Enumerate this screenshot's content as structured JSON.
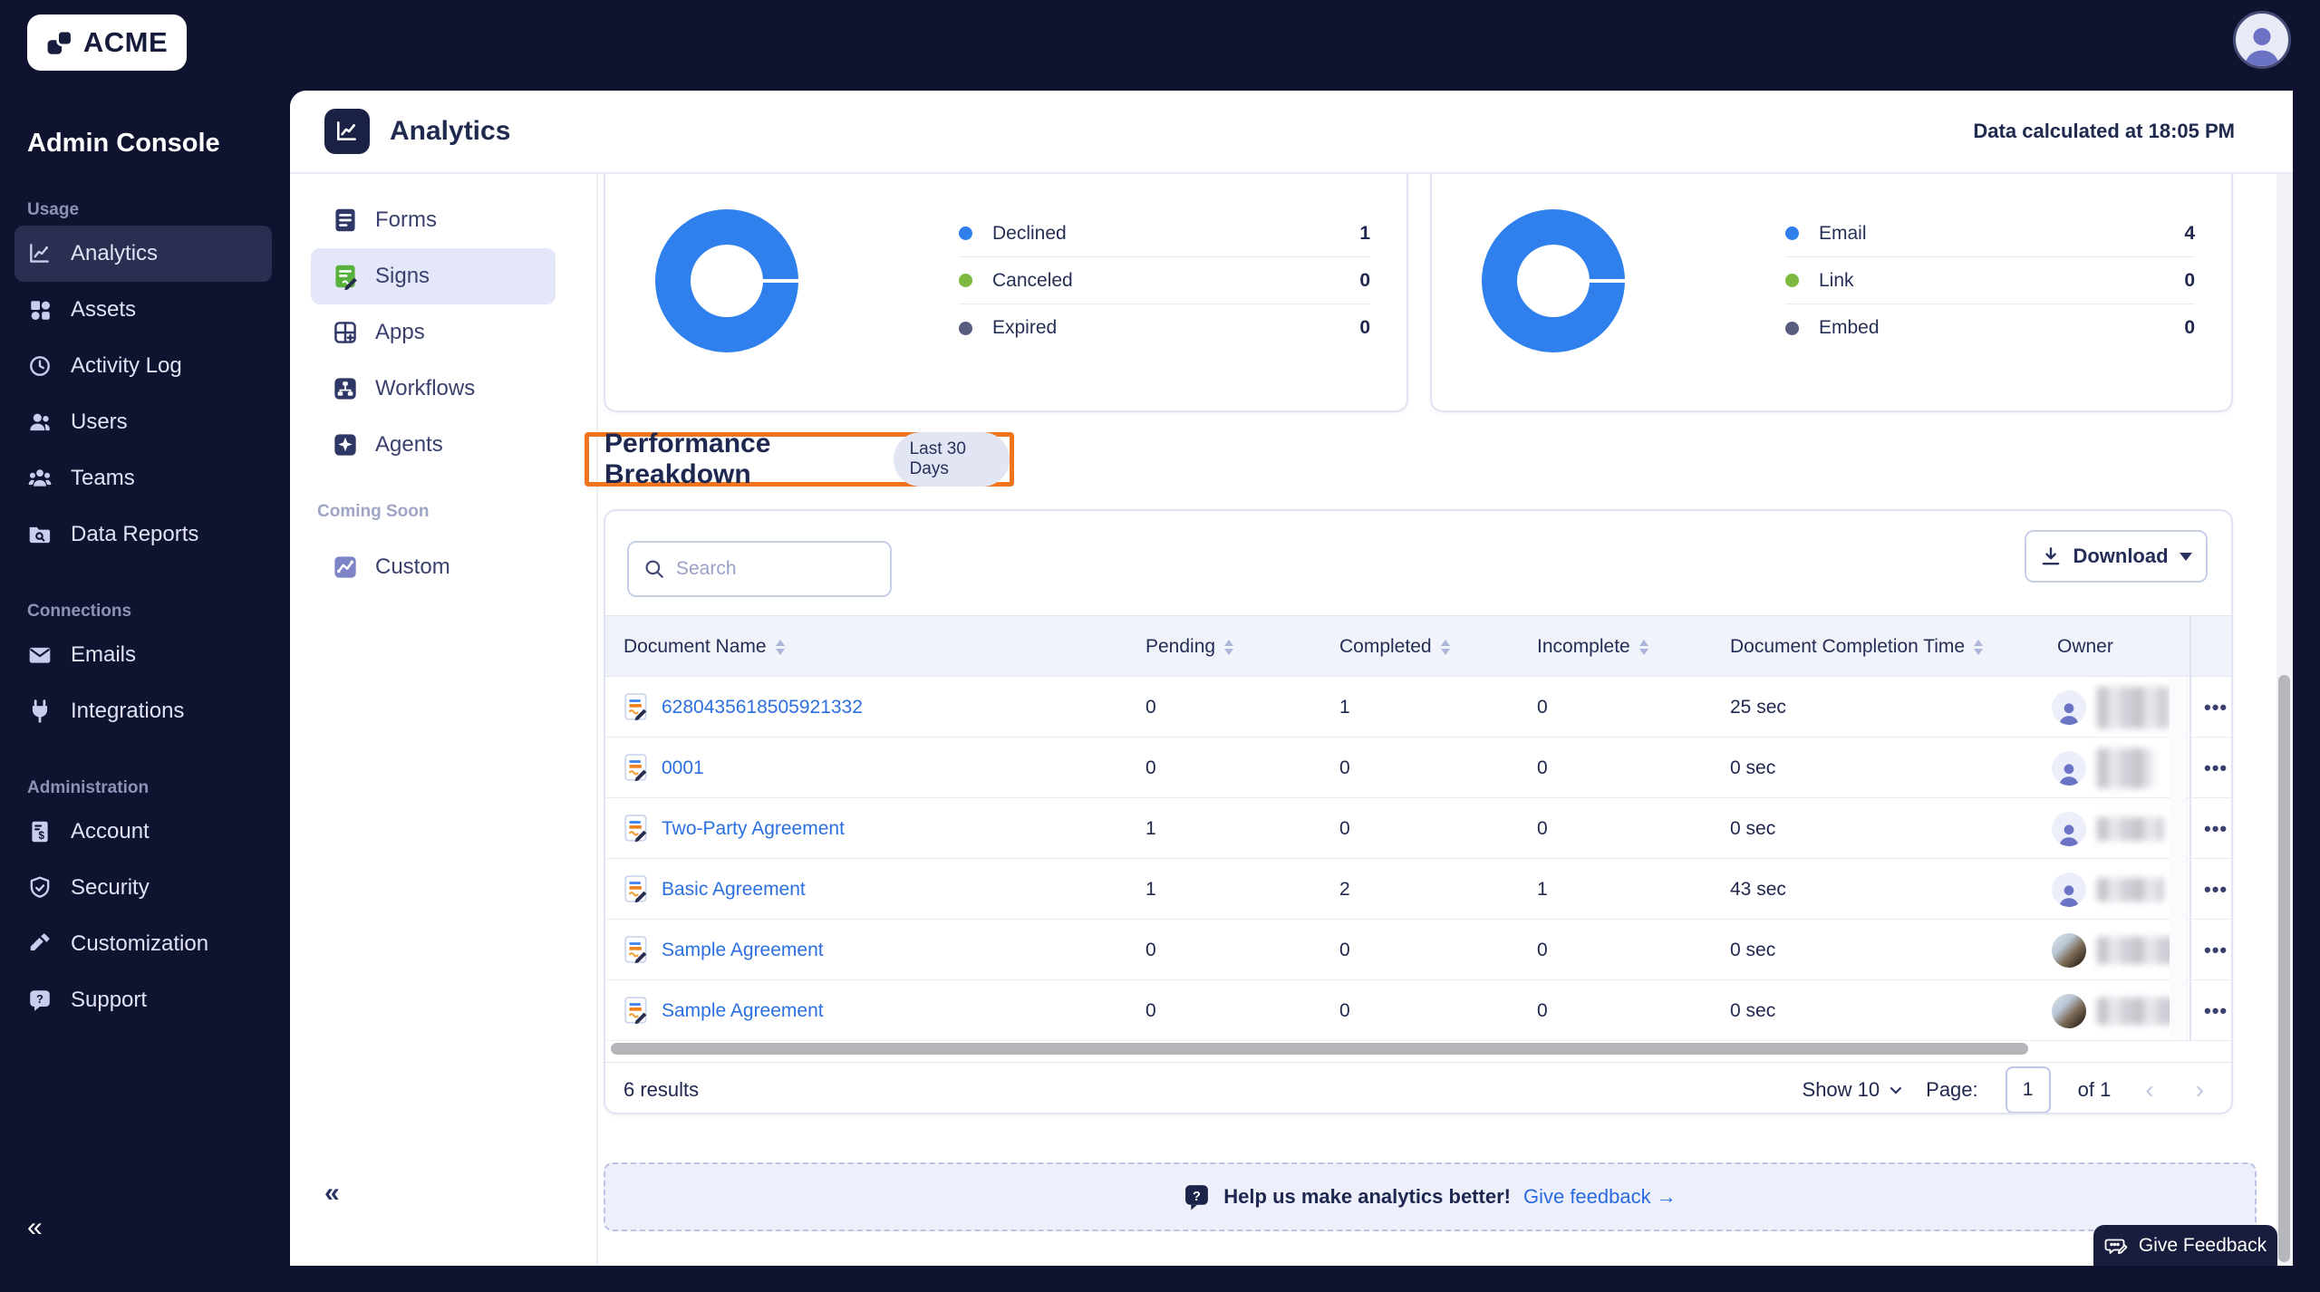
{
  "brand": {
    "name": "ACME"
  },
  "sidebar": {
    "title": "Admin Console",
    "collapse_icon": "«",
    "sections": [
      {
        "label": "Usage",
        "items": [
          {
            "label": "Analytics",
            "icon": "line-chart-icon",
            "active": true
          },
          {
            "label": "Assets",
            "icon": "shapes-icon",
            "active": false
          },
          {
            "label": "Activity Log",
            "icon": "history-clock-icon",
            "active": false
          },
          {
            "label": "Users",
            "icon": "user-icon",
            "active": false
          },
          {
            "label": "Teams",
            "icon": "team-icon",
            "active": false
          },
          {
            "label": "Data Reports",
            "icon": "folder-search-icon",
            "active": false
          }
        ]
      },
      {
        "label": "Connections",
        "items": [
          {
            "label": "Emails",
            "icon": "envelope-icon",
            "active": false
          },
          {
            "label": "Integrations",
            "icon": "plug-icon",
            "active": false
          }
        ]
      },
      {
        "label": "Administration",
        "items": [
          {
            "label": "Account",
            "icon": "billing-doc-icon",
            "active": false
          },
          {
            "label": "Security",
            "icon": "shield-check-icon",
            "active": false
          },
          {
            "label": "Customization",
            "icon": "paint-roller-icon",
            "active": false
          },
          {
            "label": "Support",
            "icon": "help-bubble-icon",
            "active": false
          }
        ]
      }
    ]
  },
  "subnav": {
    "title": "Analytics",
    "items": [
      {
        "label": "Forms",
        "icon": "form-doc-icon",
        "active": false
      },
      {
        "label": "Signs",
        "icon": "sign-doc-icon",
        "active": true
      },
      {
        "label": "Apps",
        "icon": "apps-grid-icon",
        "active": false
      },
      {
        "label": "Workflows",
        "icon": "workflow-icon",
        "active": false
      },
      {
        "label": "Agents",
        "icon": "agent-sparkle-icon",
        "active": false
      }
    ],
    "coming_soon_label": "Coming Soon",
    "coming_soon_items": [
      {
        "label": "Custom",
        "icon": "custom-chart-icon"
      }
    ],
    "collapse_icon": "«"
  },
  "header": {
    "title": "Analytics",
    "calculated_label": "Data calculated at 18:05 PM"
  },
  "chart_data": [
    {
      "type": "donut",
      "series": [
        {
          "name": "Declined",
          "value": 1,
          "color": "#2F80ED"
        },
        {
          "name": "Canceled",
          "value": 0,
          "color": "#7CB93E"
        },
        {
          "name": "Expired",
          "value": 0,
          "color": "#585D80"
        }
      ],
      "legend_position": "right"
    },
    {
      "type": "donut",
      "series": [
        {
          "name": "Email",
          "value": 4,
          "color": "#2F80ED"
        },
        {
          "name": "Link",
          "value": 0,
          "color": "#7CB93E"
        },
        {
          "name": "Embed",
          "value": 0,
          "color": "#585D80"
        }
      ],
      "legend_position": "right"
    }
  ],
  "performance": {
    "title": "Performance Breakdown",
    "badge": "Last 30 Days"
  },
  "table": {
    "search_placeholder": "Search",
    "download_label": "Download",
    "columns": [
      "Document Name",
      "Pending",
      "Completed",
      "Incomplete",
      "Document Completion Time",
      "Owner"
    ],
    "rows": [
      {
        "name": "6280435618505921332",
        "pending": 0,
        "completed": 1,
        "incomplete": 0,
        "completion_time": "25 sec",
        "owner_avatar": "person"
      },
      {
        "name": "0001",
        "pending": 0,
        "completed": 0,
        "incomplete": 0,
        "completion_time": "0 sec",
        "owner_avatar": "person"
      },
      {
        "name": "Two-Party Agreement",
        "pending": 1,
        "completed": 0,
        "incomplete": 0,
        "completion_time": "0 sec",
        "owner_avatar": "person"
      },
      {
        "name": "Basic Agreement",
        "pending": 1,
        "completed": 2,
        "incomplete": 1,
        "completion_time": "43 sec",
        "owner_avatar": "person"
      },
      {
        "name": "Sample Agreement",
        "pending": 0,
        "completed": 0,
        "incomplete": 0,
        "completion_time": "0 sec",
        "owner_avatar": "photo"
      },
      {
        "name": "Sample Agreement",
        "pending": 0,
        "completed": 0,
        "incomplete": 0,
        "completion_time": "0 sec",
        "owner_avatar": "photo"
      }
    ],
    "actions_icon": "•••",
    "footer": {
      "results": "6 results",
      "show_label": "Show 10",
      "page_label": "Page:",
      "page_value": "1",
      "of_label": "of 1",
      "prev_icon": "‹",
      "next_icon": "›"
    }
  },
  "banner": {
    "message": "Help us make analytics better!",
    "link_label": "Give feedback →"
  },
  "feedback_button": {
    "label": "Give Feedback"
  },
  "colors": {
    "accent_blue": "#2F80ED",
    "green": "#7CB93E",
    "slate": "#585D80",
    "navy_bg": "#10132F",
    "orange_highlight": "#F0741C",
    "link_blue": "#2B6FE0"
  }
}
